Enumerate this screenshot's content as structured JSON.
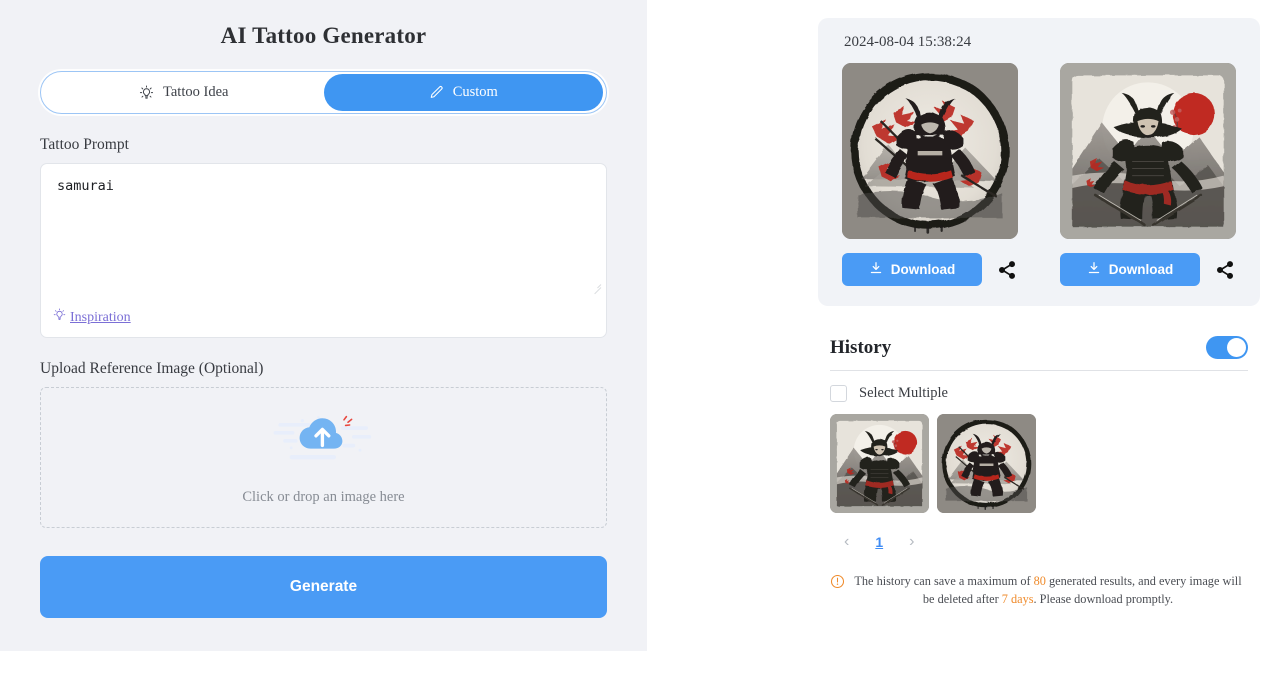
{
  "left": {
    "title": "AI Tattoo Generator",
    "tabs": [
      {
        "label": "Tattoo Idea",
        "icon": "lightbulb-icon",
        "active": false
      },
      {
        "label": "Custom",
        "icon": "pencil-icon",
        "active": true
      }
    ],
    "prompt": {
      "label": "Tattoo Prompt",
      "value": "samurai",
      "placeholder": "",
      "inspiration_label": "Inspiration",
      "inspiration_icon": "lightbulb-icon"
    },
    "upload": {
      "label": "Upload Reference Image (Optional)",
      "hint": "Click or drop an image here",
      "icon": "cloud-upload-icon"
    },
    "generate_label": "Generate"
  },
  "right": {
    "result": {
      "timestamp": "2024-08-04 15:38:24",
      "items": [
        {
          "alt": "samurai-tattoo-circular-ink",
          "download_label": "Download",
          "download_icon": "download-icon",
          "share_icon": "share-icon"
        },
        {
          "alt": "samurai-tattoo-red-sun",
          "download_label": "Download",
          "download_icon": "download-icon",
          "share_icon": "share-icon"
        }
      ]
    },
    "history": {
      "title": "History",
      "toggle_on": true,
      "select_multiple_label": "Select Multiple",
      "select_multiple_checked": false,
      "thumbs": [
        {
          "alt": "samurai-tattoo-red-sun"
        },
        {
          "alt": "samurai-tattoo-circular-ink"
        }
      ],
      "pagination": {
        "prev": "‹",
        "current": "1",
        "next": "›"
      },
      "note": {
        "icon": "warning-circle-icon",
        "part1": "The history can save a maximum of ",
        "max_results": "80",
        "part2": " generated results, and every image will be deleted after ",
        "retention": "7 days",
        "part3": ". Please download promptly."
      }
    }
  },
  "colors": {
    "accent_blue": "#4a9bf5",
    "tab_blue": "#3f96f2",
    "panel_gray": "#f1f2f6",
    "warning_orange": "#ef8b2c",
    "link_purple": "#7b6fd6"
  }
}
